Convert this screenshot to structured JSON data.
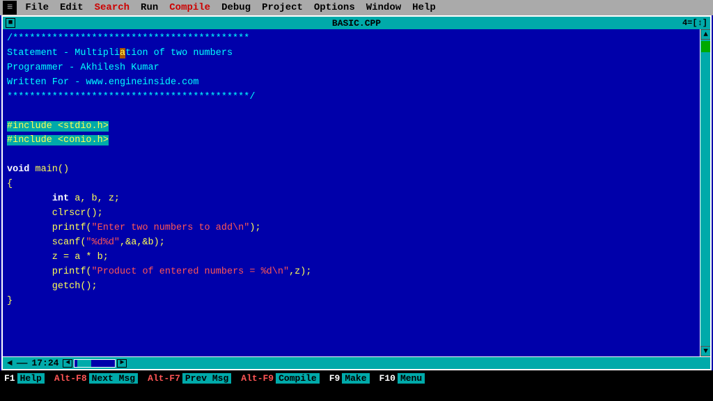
{
  "menubar": {
    "icon": "≡",
    "items": [
      {
        "label": "File",
        "color": "normal"
      },
      {
        "label": "Edit",
        "color": "normal"
      },
      {
        "label": "Search",
        "color": "red"
      },
      {
        "label": "Run",
        "color": "normal"
      },
      {
        "label": "Compile",
        "color": "red"
      },
      {
        "label": "Debug",
        "color": "normal"
      },
      {
        "label": "Project",
        "color": "normal"
      },
      {
        "label": "Options",
        "color": "normal"
      },
      {
        "label": "Window",
        "color": "normal"
      },
      {
        "label": "Help",
        "color": "normal"
      }
    ]
  },
  "editor": {
    "title": "BASIC.CPP",
    "window_number": "4",
    "close_btn": "■",
    "arrows_right": "↕",
    "code_lines": [
      "/******************************************",
      "Statement - Multipli█ation of two numbers",
      "Programmer - Akhilesh Kumar",
      "Written For - www.engineinside.com",
      "*******************************************/",
      "",
      "#include <stdio.h>",
      "#include <conio.h>",
      "",
      "void main()",
      "{",
      "        int a, b, z;",
      "        clrscr();",
      "        printf(\"Enter two numbers to add\\n\");",
      "        scanf(\"%d%d\",&a,&b);",
      "        z = a * b;",
      "        printf(\"Product of entered numbers = %d\\n\",z);",
      "        getch();",
      "}"
    ],
    "time": "17:24"
  },
  "bottombar": {
    "keys": [
      {
        "num": "F1",
        "label": "Help"
      },
      {
        "num": "Alt-F8",
        "label": "Next Msg",
        "alt": true
      },
      {
        "num": "Alt-F7",
        "label": "Prev Msg",
        "alt": true
      },
      {
        "num": "Alt-F9",
        "label": "Compile",
        "alt": true
      },
      {
        "num": "F9",
        "label": "Make"
      },
      {
        "num": "F10",
        "label": "Menu"
      }
    ]
  },
  "colors": {
    "bg": "#0000aa",
    "menubar_bg": "#aaaaaa",
    "titlebar_bg": "#00aaaa",
    "comment": "#00ffff",
    "keyword": "#ffffff",
    "string": "#ff5555",
    "normal_code": "#ffff55",
    "include_bg": "#00aaaa",
    "cursor_bg": "#aa5500"
  }
}
